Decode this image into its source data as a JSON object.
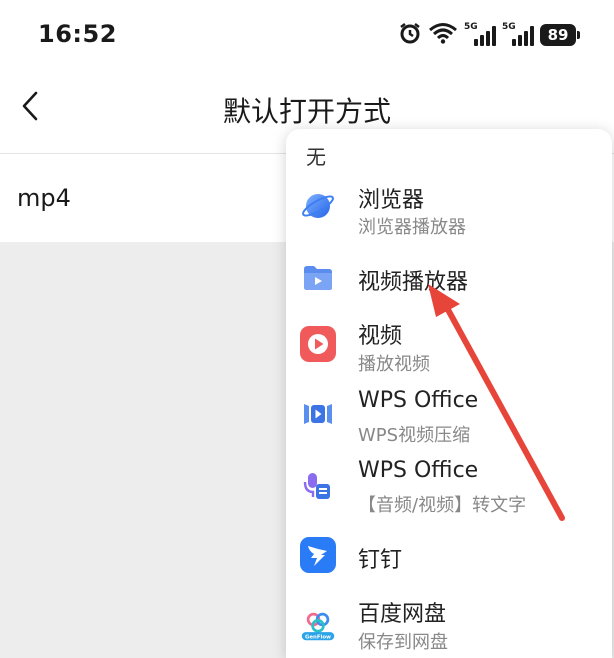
{
  "status": {
    "time": "16:52",
    "network_label": "5G",
    "battery": "89"
  },
  "header": {
    "title": "默认打开方式"
  },
  "file": {
    "extension": "mp4"
  },
  "menu": {
    "none_label": "无",
    "items": [
      {
        "label": "浏览器",
        "sub": "浏览器播放器",
        "icon": "planet-icon"
      },
      {
        "label": "视频播放器",
        "sub": "",
        "icon": "video-folder-icon"
      },
      {
        "label": "视频",
        "sub": "播放视频",
        "icon": "play-icon"
      },
      {
        "label": "WPS Office",
        "sub": "WPS视频压缩",
        "icon": "wps-video-compress-icon"
      },
      {
        "label": "WPS Office",
        "sub": "【音频/视频】转文字",
        "icon": "wps-speech-to-text-icon"
      },
      {
        "label": "钉钉",
        "sub": "",
        "icon": "dingtalk-icon"
      },
      {
        "label": "百度网盘",
        "sub": "保存到网盘",
        "icon": "baidu-netdisk-icon"
      }
    ],
    "baidu_icon_caption": "GenFlow"
  },
  "colors": {
    "annotation_arrow": "#e8453a",
    "video_red": "#f05a5a",
    "folder_blue": "#5b8def",
    "dingtalk_blue": "#2a7cf6"
  }
}
